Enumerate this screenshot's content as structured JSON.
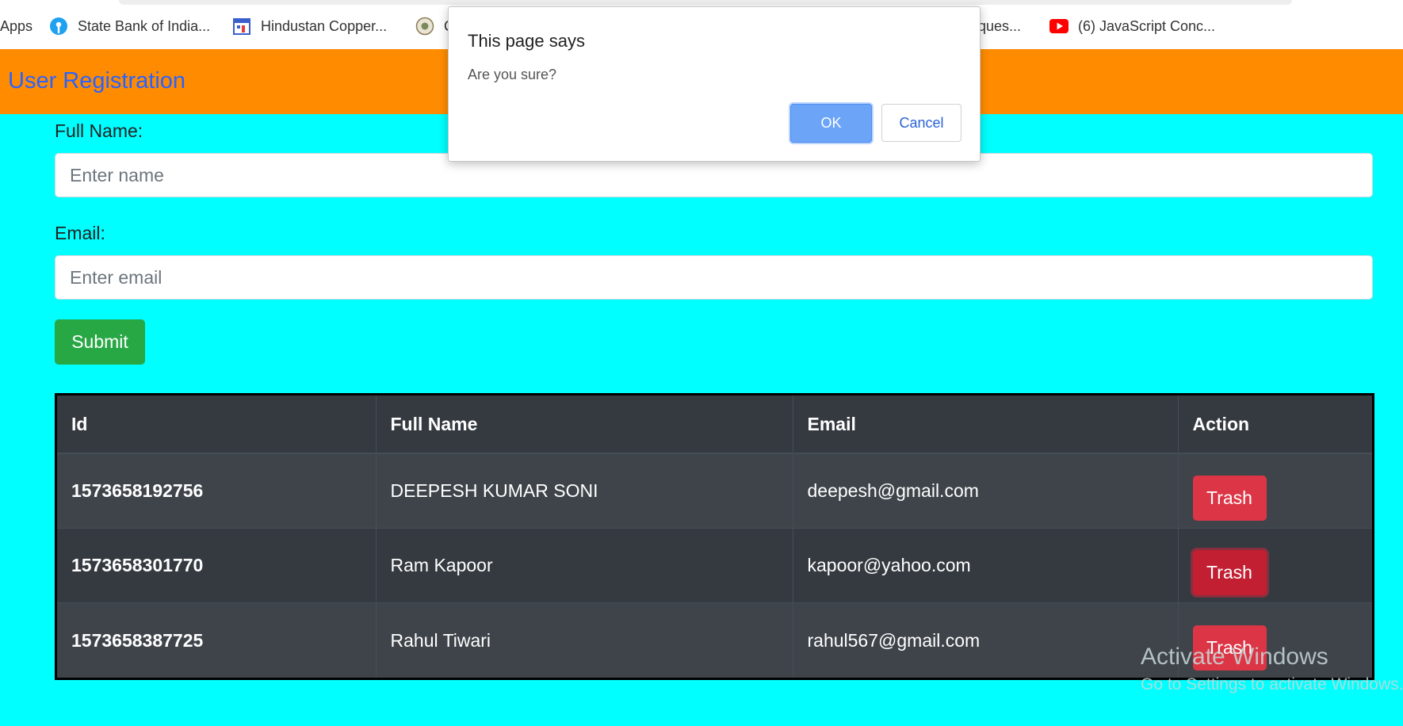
{
  "bookmarks": {
    "items": [
      {
        "label": "Apps",
        "icon": "apps-grid-icon"
      },
      {
        "label": "State Bank of India...",
        "icon": "sbi-logo-icon"
      },
      {
        "label": "Hindustan Copper...",
        "icon": "calendar-icon"
      },
      {
        "label": "C",
        "icon": "emblem-icon"
      },
      {
        "label": "ques...",
        "icon": ""
      },
      {
        "label": "(6) JavaScript Conc...",
        "icon": "youtube-icon"
      }
    ]
  },
  "navbar": {
    "brand": "User Registration",
    "color": "#ff8c00",
    "brand_color": "#2a62ff"
  },
  "form": {
    "name_label": "Full Name:",
    "name_placeholder": "Enter name",
    "email_label": "Email:",
    "email_placeholder": "Enter email",
    "submit_label": "Submit"
  },
  "table": {
    "headers": [
      "Id",
      "Full Name",
      "Email",
      "Action"
    ],
    "rows": [
      {
        "id": "1573658192756",
        "name": "DEEPESH KUMAR SONI",
        "email": "deepesh@gmail.com",
        "action": "Trash"
      },
      {
        "id": "1573658301770",
        "name": "Ram Kapoor",
        "email": "kapoor@yahoo.com",
        "action": "Trash"
      },
      {
        "id": "1573658387725",
        "name": "Rahul Tiwari",
        "email": "rahul567@gmail.com",
        "action": "Trash"
      }
    ]
  },
  "dialog": {
    "title": "This page says",
    "message": "Are you sure?",
    "ok_label": "OK",
    "cancel_label": "Cancel"
  },
  "watermark": {
    "line1": "Activate Windows",
    "line2": "Go to Settings to activate Windows."
  },
  "colors": {
    "page_bg": "#00ffff",
    "submit": "#28a745",
    "trash": "#dc3545",
    "table_bg": "#343a40"
  }
}
